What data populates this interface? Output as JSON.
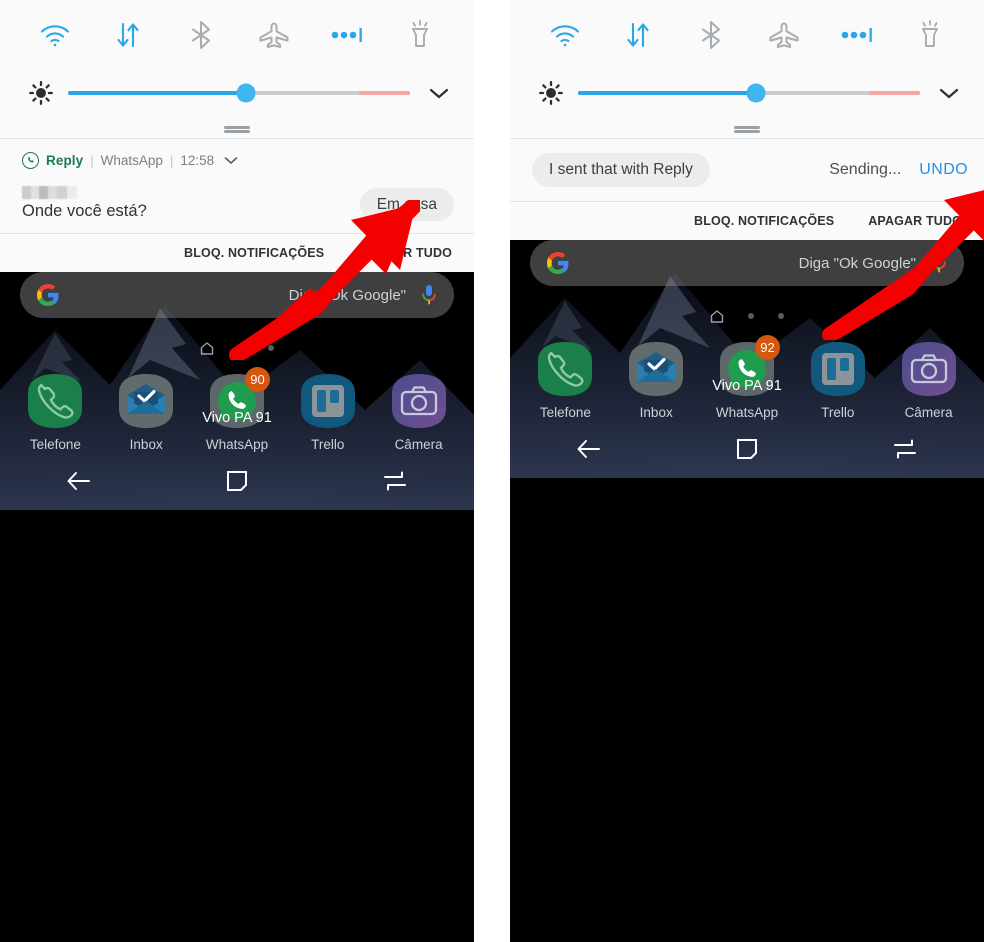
{
  "panels": [
    {
      "id": "before",
      "quick_settings": {
        "toggles": [
          {
            "name": "wifi-toggle",
            "icon": "wifi-icon",
            "state": "on",
            "color": "#29a7e8"
          },
          {
            "name": "mobile-data-toggle",
            "icon": "data-transfer-icon",
            "state": "on",
            "color": "#29a7e8"
          },
          {
            "name": "bluetooth-toggle",
            "icon": "bluetooth-icon",
            "state": "off",
            "color": "#a8adb1"
          },
          {
            "name": "airplane-mode-toggle",
            "icon": "airplane-icon",
            "state": "off",
            "color": "#a8adb1"
          },
          {
            "name": "more-toggles-button",
            "icon": "more-dots-icon",
            "state": "on",
            "color": "#29a7e8"
          },
          {
            "name": "flashlight-toggle",
            "icon": "flashlight-icon",
            "state": "off",
            "color": "#a8adb1"
          }
        ],
        "brightness": {
          "icon": "brightness-icon",
          "value_percent": 52,
          "warm_start_percent": 85,
          "fill_color": "#2aa5e8",
          "track_color": "#c8ccce",
          "warm_color": "#f6a6a6"
        },
        "expand_icon": "chevron-down-icon"
      },
      "notification": {
        "app_badge_icon": "whatsapp-icon",
        "app_name": "Reply",
        "source": "WhatsApp",
        "time": "12:58",
        "expand_icon": "chevron-down-icon",
        "sender": "",
        "message": "Onde você está?",
        "quick_reply": "Em casa"
      },
      "actions": {
        "block": "BLOQ. NOTIFICAÇÕES",
        "clear_all": "APAGAR TUDO"
      },
      "home": {
        "search_placeholder": "Diga \"Ok Google\"",
        "search_icon": "google-g-icon",
        "mic_icon": "microphone-icon",
        "wifi_network_label": "Vivo PA 91",
        "page_indicator": {
          "home_icon": "home-page-icon",
          "dots": 2
        },
        "dock": [
          {
            "label": "Telefone",
            "icon": "phone-icon",
            "badge": null
          },
          {
            "label": "Inbox",
            "icon": "inbox-icon",
            "badge": null
          },
          {
            "label": "WhatsApp",
            "icon": "whatsapp-app-icon",
            "badge": "90"
          },
          {
            "label": "Trello",
            "icon": "trello-icon",
            "badge": null
          },
          {
            "label": "Câmera",
            "icon": "camera-icon",
            "badge": null
          }
        ],
        "navbar": [
          {
            "name": "back-button",
            "icon": "back-arrow-icon"
          },
          {
            "name": "home-button",
            "icon": "home-square-icon"
          },
          {
            "name": "recents-button",
            "icon": "recents-icon"
          }
        ]
      },
      "annotation": {
        "type": "arrow",
        "color": "#f50000",
        "points_to": "Em casa"
      }
    },
    {
      "id": "after",
      "quick_settings": {
        "toggles": [
          {
            "name": "wifi-toggle",
            "icon": "wifi-icon",
            "state": "on",
            "color": "#29a7e8"
          },
          {
            "name": "mobile-data-toggle",
            "icon": "data-transfer-icon",
            "state": "on",
            "color": "#29a7e8"
          },
          {
            "name": "bluetooth-toggle",
            "icon": "bluetooth-icon",
            "state": "off",
            "color": "#a8adb1"
          },
          {
            "name": "airplane-mode-toggle",
            "icon": "airplane-icon",
            "state": "off",
            "color": "#a8adb1"
          },
          {
            "name": "more-toggles-button",
            "icon": "more-dots-icon",
            "state": "on",
            "color": "#29a7e8"
          },
          {
            "name": "flashlight-toggle",
            "icon": "flashlight-icon",
            "state": "off",
            "color": "#a8adb1"
          }
        ],
        "brightness": {
          "icon": "brightness-icon",
          "value_percent": 52,
          "warm_start_percent": 85,
          "fill_color": "#2aa5e8",
          "track_color": "#c8ccce",
          "warm_color": "#f6a6a6"
        },
        "expand_icon": "chevron-down-icon"
      },
      "notification_sent": {
        "sent_pill": "I sent that with Reply",
        "status": "Sending...",
        "undo": "UNDO",
        "undo_color": "#2a8df0"
      },
      "actions": {
        "block": "BLOQ. NOTIFICAÇÕES",
        "clear_all": "APAGAR TUDO"
      },
      "home": {
        "search_placeholder": "Diga \"Ok Google\"",
        "search_icon": "google-g-icon",
        "mic_icon": "microphone-icon",
        "wifi_network_label": "Vivo PA 91",
        "page_indicator": {
          "home_icon": "home-page-icon",
          "dots": 2
        },
        "dock": [
          {
            "label": "Telefone",
            "icon": "phone-icon",
            "badge": null
          },
          {
            "label": "Inbox",
            "icon": "inbox-icon",
            "badge": null
          },
          {
            "label": "WhatsApp",
            "icon": "whatsapp-app-icon",
            "badge": "92"
          },
          {
            "label": "Trello",
            "icon": "trello-icon",
            "badge": null
          },
          {
            "label": "Câmera",
            "icon": "camera-icon",
            "badge": null
          }
        ],
        "navbar": [
          {
            "name": "back-button",
            "icon": "back-arrow-icon"
          },
          {
            "name": "home-button",
            "icon": "home-square-icon"
          },
          {
            "name": "recents-button",
            "icon": "recents-icon"
          }
        ]
      },
      "annotation": {
        "type": "arrow",
        "color": "#f50000",
        "points_to": "UNDO"
      }
    }
  ]
}
